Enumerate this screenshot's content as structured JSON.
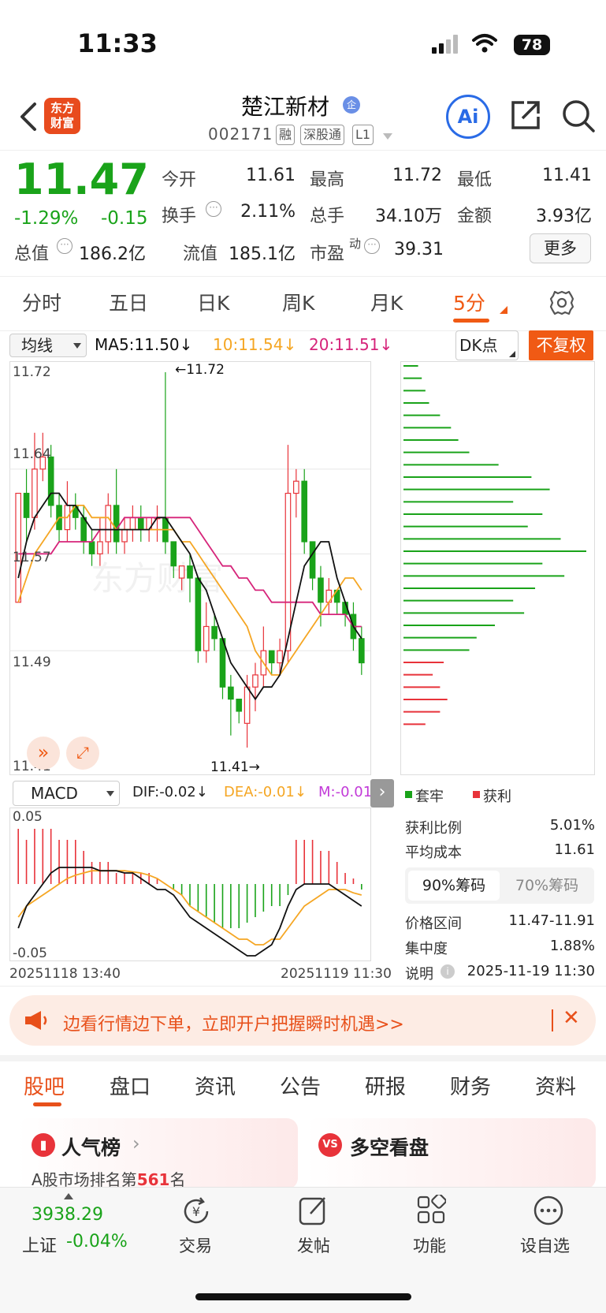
{
  "status_bar": {
    "time": "11:33",
    "battery": "78"
  },
  "header": {
    "logo_line1": "东方",
    "logo_line2": "财富",
    "stock_name": "楚江新材",
    "name_badge": "企",
    "stock_code": "002171",
    "tags": [
      "融",
      "深股通",
      "L1"
    ],
    "ai_label": "Ai"
  },
  "quote": {
    "price": "11.47",
    "change_pct": "-1.29%",
    "change": "-0.15",
    "open_label": "今开",
    "open": "11.61",
    "high_label": "最高",
    "high": "11.72",
    "low_label": "最低",
    "low": "11.41",
    "turnover_label": "换手",
    "turnover": "2.11%",
    "volume_label": "总手",
    "volume": "34.10万",
    "amount_label": "金额",
    "amount": "3.93亿",
    "mktcap_label": "总值",
    "mktcap": "186.2亿",
    "float_label": "流值",
    "float_cap": "185.1亿",
    "pe_label": "市盈",
    "pe_sup": "动",
    "pe": "39.31",
    "more_label": "更多"
  },
  "period_tabs": [
    "分时",
    "五日",
    "日K",
    "周K",
    "月K",
    "5分"
  ],
  "active_period": "5分",
  "chart_toolbar": {
    "ma_select": "均线",
    "ma5": "MA5:11.50↓",
    "ma10": "10:11.54↓",
    "ma20": "20:11.51↓",
    "dk_select": "DK点",
    "adjust_button": "不复权"
  },
  "price_axis": {
    "top": "11.72",
    "upper": "11.64",
    "mid": "11.57",
    "lower": "11.49",
    "bottom": "11.41"
  },
  "annotations": {
    "high": "←11.72",
    "low": "11.41→"
  },
  "macd_toolbar": {
    "select": "MACD",
    "dif": "DIF:-0.02↓",
    "dea": "DEA:-0.01↓",
    "m": "M:-0.01"
  },
  "macd_axis": {
    "top": "0.05",
    "bottom": "-0.05"
  },
  "time_axis": {
    "start": "20251118 13:40",
    "end": "20251119 11:30"
  },
  "colors": {
    "up": "#e8333a",
    "down": "#1aa31a",
    "ma5": "#111111",
    "ma10": "#f5a623",
    "ma20": "#d6247a",
    "accent": "#f05a14"
  },
  "chart_data": {
    "type": "candlestick",
    "ylim": [
      11.41,
      11.72
    ],
    "candles": [
      {
        "o": 11.53,
        "c": 11.62,
        "h": 11.62,
        "l": 11.53
      },
      {
        "o": 11.62,
        "c": 11.6,
        "h": 11.64,
        "l": 11.58
      },
      {
        "o": 11.6,
        "c": 11.64,
        "h": 11.67,
        "l": 11.59
      },
      {
        "o": 11.64,
        "c": 11.65,
        "h": 11.67,
        "l": 11.63
      },
      {
        "o": 11.65,
        "c": 11.61,
        "h": 11.66,
        "l": 11.6
      },
      {
        "o": 11.61,
        "c": 11.59,
        "h": 11.62,
        "l": 11.58
      },
      {
        "o": 11.59,
        "c": 11.61,
        "h": 11.63,
        "l": 11.58
      },
      {
        "o": 11.61,
        "c": 11.6,
        "h": 11.62,
        "l": 11.59
      },
      {
        "o": 11.6,
        "c": 11.58,
        "h": 11.61,
        "l": 11.57
      },
      {
        "o": 11.58,
        "c": 11.57,
        "h": 11.59,
        "l": 11.56
      },
      {
        "o": 11.57,
        "c": 11.58,
        "h": 11.6,
        "l": 11.56
      },
      {
        "o": 11.58,
        "c": 11.61,
        "h": 11.62,
        "l": 11.57
      },
      {
        "o": 11.61,
        "c": 11.58,
        "h": 11.64,
        "l": 11.57
      },
      {
        "o": 11.58,
        "c": 11.59,
        "h": 11.6,
        "l": 11.57
      },
      {
        "o": 11.59,
        "c": 11.6,
        "h": 11.61,
        "l": 11.58
      },
      {
        "o": 11.6,
        "c": 11.59,
        "h": 11.61,
        "l": 11.58
      },
      {
        "o": 11.59,
        "c": 11.6,
        "h": 11.6,
        "l": 11.58
      },
      {
        "o": 11.6,
        "c": 11.6,
        "h": 11.61,
        "l": 11.58
      },
      {
        "o": 11.6,
        "c": 11.58,
        "h": 11.72,
        "l": 11.57
      },
      {
        "o": 11.58,
        "c": 11.56,
        "h": 11.58,
        "l": 11.55
      },
      {
        "o": 11.55,
        "c": 11.56,
        "h": 11.56,
        "l": 11.54
      },
      {
        "o": 11.56,
        "c": 11.55,
        "h": 11.57,
        "l": 11.53
      },
      {
        "o": 11.55,
        "c": 11.49,
        "h": 11.55,
        "l": 11.48
      },
      {
        "o": 11.49,
        "c": 11.51,
        "h": 11.53,
        "l": 11.48
      },
      {
        "o": 11.51,
        "c": 11.5,
        "h": 11.52,
        "l": 11.49
      },
      {
        "o": 11.5,
        "c": 11.46,
        "h": 11.5,
        "l": 11.45
      },
      {
        "o": 11.46,
        "c": 11.45,
        "h": 11.47,
        "l": 11.42
      },
      {
        "o": 11.45,
        "c": 11.44,
        "h": 11.45,
        "l": 11.43
      },
      {
        "o": 11.43,
        "c": 11.46,
        "h": 11.47,
        "l": 11.41
      },
      {
        "o": 11.46,
        "c": 11.47,
        "h": 11.48,
        "l": 11.44
      },
      {
        "o": 11.47,
        "c": 11.49,
        "h": 11.51,
        "l": 11.46
      },
      {
        "o": 11.49,
        "c": 11.48,
        "h": 11.49,
        "l": 11.47
      },
      {
        "o": 11.48,
        "c": 11.49,
        "h": 11.5,
        "l": 11.47
      },
      {
        "o": 11.49,
        "c": 11.62,
        "h": 11.66,
        "l": 11.48
      },
      {
        "o": 11.62,
        "c": 11.63,
        "h": 11.64,
        "l": 11.6
      },
      {
        "o": 11.63,
        "c": 11.58,
        "h": 11.64,
        "l": 11.57
      },
      {
        "o": 11.58,
        "c": 11.55,
        "h": 11.58,
        "l": 11.54
      },
      {
        "o": 11.55,
        "c": 11.53,
        "h": 11.56,
        "l": 11.51
      },
      {
        "o": 11.53,
        "c": 11.54,
        "h": 11.55,
        "l": 11.52
      },
      {
        "o": 11.54,
        "c": 11.53,
        "h": 11.54,
        "l": 11.52
      },
      {
        "o": 11.53,
        "c": 11.52,
        "h": 11.53,
        "l": 11.51
      },
      {
        "o": 11.52,
        "c": 11.5,
        "h": 11.53,
        "l": 11.49
      },
      {
        "o": 11.5,
        "c": 11.48,
        "h": 11.51,
        "l": 11.47
      }
    ],
    "ma5": [
      11.55,
      11.58,
      11.6,
      11.61,
      11.62,
      11.62,
      11.61,
      11.61,
      11.6,
      11.59,
      11.59,
      11.59,
      11.59,
      11.59,
      11.59,
      11.59,
      11.59,
      11.6,
      11.6,
      11.59,
      11.58,
      11.57,
      11.55,
      11.54,
      11.52,
      11.5,
      11.48,
      11.47,
      11.46,
      11.45,
      11.46,
      11.46,
      11.47,
      11.5,
      11.53,
      11.56,
      11.57,
      11.58,
      11.58,
      11.55,
      11.53,
      11.51,
      11.5
    ],
    "ma10": [
      11.53,
      11.55,
      11.57,
      11.58,
      11.59,
      11.6,
      11.6,
      11.61,
      11.61,
      11.6,
      11.6,
      11.6,
      11.59,
      11.59,
      11.59,
      11.59,
      11.59,
      11.59,
      11.59,
      11.59,
      11.58,
      11.58,
      11.57,
      11.56,
      11.55,
      11.54,
      11.53,
      11.52,
      11.51,
      11.49,
      11.48,
      11.47,
      11.47,
      11.48,
      11.49,
      11.5,
      11.51,
      11.52,
      11.53,
      11.54,
      11.55,
      11.55,
      11.54
    ],
    "ma20": [
      11.57,
      11.57,
      11.57,
      11.57,
      11.57,
      11.58,
      11.58,
      11.58,
      11.58,
      11.58,
      11.59,
      11.59,
      11.59,
      11.6,
      11.6,
      11.6,
      11.6,
      11.6,
      11.6,
      11.6,
      11.6,
      11.6,
      11.59,
      11.58,
      11.57,
      11.56,
      11.56,
      11.55,
      11.55,
      11.54,
      11.54,
      11.53,
      11.53,
      11.53,
      11.53,
      11.53,
      11.53,
      11.52,
      11.52,
      11.52,
      11.52,
      11.51,
      11.51
    ],
    "macd_bars": [
      0.05,
      0.04,
      0.05,
      0.05,
      0.05,
      0.04,
      0.04,
      0.04,
      0.03,
      0.02,
      0.02,
      0.02,
      0.01,
      0.01,
      0.01,
      0.01,
      0.01,
      0.005,
      0.0,
      -0.005,
      -0.01,
      -0.02,
      -0.025,
      -0.03,
      -0.035,
      -0.04,
      -0.04,
      -0.04,
      -0.035,
      -0.03,
      -0.025,
      -0.02,
      -0.02,
      -0.01,
      0.04,
      0.04,
      0.04,
      0.03,
      0.03,
      0.02,
      0.01,
      0.005,
      -0.005
    ],
    "dif": [
      -0.04,
      -0.02,
      -0.01,
      0.0,
      0.01,
      0.015,
      0.015,
      0.015,
      0.015,
      0.015,
      0.012,
      0.012,
      0.012,
      0.01,
      0.01,
      0.005,
      0.0,
      -0.005,
      -0.005,
      -0.01,
      -0.02,
      -0.03,
      -0.035,
      -0.04,
      -0.045,
      -0.05,
      -0.055,
      -0.06,
      -0.065,
      -0.065,
      -0.06,
      -0.055,
      -0.04,
      -0.02,
      -0.005,
      0.0,
      0.0,
      0.0,
      0.0,
      -0.005,
      -0.01,
      -0.015,
      -0.02
    ],
    "dea": [
      -0.03,
      -0.02,
      -0.015,
      -0.01,
      -0.005,
      0.0,
      0.005,
      0.008,
      0.01,
      0.012,
      0.012,
      0.012,
      0.012,
      0.012,
      0.011,
      0.01,
      0.008,
      0.005,
      0.0,
      -0.005,
      -0.01,
      -0.02,
      -0.025,
      -0.03,
      -0.035,
      -0.04,
      -0.045,
      -0.05,
      -0.05,
      -0.055,
      -0.055,
      -0.05,
      -0.05,
      -0.04,
      -0.03,
      -0.02,
      -0.015,
      -0.01,
      -0.005,
      -0.005,
      -0.005,
      -0.008,
      -0.01
    ],
    "chip_profile": [
      {
        "w": 0.08,
        "t": "p"
      },
      {
        "w": 0.1,
        "t": "p"
      },
      {
        "w": 0.12,
        "t": "p"
      },
      {
        "w": 0.14,
        "t": "p"
      },
      {
        "w": 0.2,
        "t": "p"
      },
      {
        "w": 0.26,
        "t": "p"
      },
      {
        "w": 0.3,
        "t": "p"
      },
      {
        "w": 0.36,
        "t": "p"
      },
      {
        "w": 0.52,
        "t": "p"
      },
      {
        "w": 0.7,
        "t": "p"
      },
      {
        "w": 0.8,
        "t": "p"
      },
      {
        "w": 0.6,
        "t": "p"
      },
      {
        "w": 0.76,
        "t": "p"
      },
      {
        "w": 0.68,
        "t": "p"
      },
      {
        "w": 0.86,
        "t": "p"
      },
      {
        "w": 1.0,
        "t": "p"
      },
      {
        "w": 0.76,
        "t": "p"
      },
      {
        "w": 0.88,
        "t": "p"
      },
      {
        "w": 0.72,
        "t": "p"
      },
      {
        "w": 0.6,
        "t": "p"
      },
      {
        "w": 0.66,
        "t": "p"
      },
      {
        "w": 0.5,
        "t": "p"
      },
      {
        "w": 0.4,
        "t": "p"
      },
      {
        "w": 0.36,
        "t": "p"
      },
      {
        "w": 0.22,
        "t": "l"
      },
      {
        "w": 0.16,
        "t": "l"
      },
      {
        "w": 0.2,
        "t": "l"
      },
      {
        "w": 0.24,
        "t": "l"
      },
      {
        "w": 0.2,
        "t": "l"
      },
      {
        "w": 0.12,
        "t": "l"
      }
    ]
  },
  "side_panel": {
    "legend_trapped": "套牢",
    "legend_profit": "获利",
    "profit_ratio_label": "获利比例",
    "profit_ratio": "5.01%",
    "avg_cost_label": "平均成本",
    "avg_cost": "11.61",
    "tab_90": "90%筹码",
    "tab_70": "70%筹码",
    "price_range_label": "价格区间",
    "price_range": "11.47-11.91",
    "concentration_label": "集中度",
    "concentration": "1.88%",
    "note_label": "说明",
    "note_time": "2025-11-19 11:30"
  },
  "promo": {
    "text": "边看行情边下单，立即开户把握瞬时机遇>>"
  },
  "content_tabs": [
    "股吧",
    "盘口",
    "资讯",
    "公告",
    "研报",
    "财务",
    "资料"
  ],
  "cards": {
    "popularity_title": "人气榜",
    "popularity_sub_prefix": "A股市场排名第",
    "popularity_rank": "561",
    "popularity_sub_suffix": "名",
    "bullbear_title": "多空看盘"
  },
  "bottom_nav": {
    "index_value": "3938.29",
    "index_name": "上证",
    "index_change": "-0.04%",
    "items": [
      "交易",
      "发帖",
      "功能",
      "设自选"
    ]
  }
}
